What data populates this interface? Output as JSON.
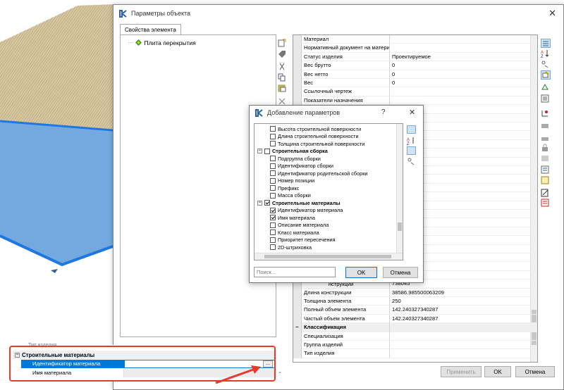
{
  "window": {
    "title": "Параметры объекта",
    "close": "✕",
    "tab": "Свойства элемента",
    "tree_item": "Плита перекрытия"
  },
  "grid": {
    "rows": [
      {
        "name": "Материал",
        "value": "",
        "cat": false
      },
      {
        "name": "Нормативный документ на материал",
        "value": "",
        "cat": false
      },
      {
        "name": "Статус изделия",
        "value": "Проектируемое",
        "cat": false
      },
      {
        "name": "Вес брутто",
        "value": "0",
        "cat": false
      },
      {
        "name": "Вес нетто",
        "value": "0",
        "cat": false
      },
      {
        "name": "Вес",
        "value": "0",
        "cat": false
      },
      {
        "name": "Ссылочный чертеж",
        "value": "",
        "cat": false
      },
      {
        "name": "Показатели назначения",
        "value": "",
        "cat": false
      },
      {
        "name": "",
        "value": "",
        "cat": false
      },
      {
        "name": "",
        "value": "",
        "cat": false
      },
      {
        "name": "",
        "value": "",
        "cat": false
      },
      {
        "name": "",
        "value": "",
        "cat": false
      },
      {
        "name": "",
        "value": "",
        "cat": false
      },
      {
        "name": "",
        "value": "",
        "cat": false
      },
      {
        "name": "",
        "value": "",
        "cat": false
      },
      {
        "name": "",
        "value": "",
        "cat": false
      },
      {
        "name": "",
        "value": "",
        "cat": false
      },
      {
        "name": "",
        "value": "",
        "cat": false
      },
      {
        "name": "",
        "value": "",
        "cat": false
      },
      {
        "name": "",
        "value": "",
        "cat": false
      },
      {
        "name": "",
        "value": "1148",
        "cat": false
      },
      {
        "name": "",
        "value": "1148",
        "cat": false
      },
      {
        "name": "",
        "value": "",
        "cat": false
      },
      {
        "name": "",
        "value": "",
        "cat": false
      },
      {
        "name": "",
        "value": "оверхность",
        "cat": false
      },
      {
        "name": "",
        "value": "",
        "cat": false
      },
      {
        "name": "",
        "value": "",
        "cat": false
      },
      {
        "name": "",
        "value": "",
        "cat": false
      },
      {
        "name": "",
        "value": "738045",
        "cat": false
      },
      {
        "name": "Длина конструкции",
        "value": "38586.985500063209",
        "cat": false
      },
      {
        "name": "Толщина элемента",
        "value": "250",
        "cat": false
      },
      {
        "name": "Полный объем элемента",
        "value": "142.240327340287",
        "cat": false
      },
      {
        "name": "Чистый объем элемента",
        "value": "142.240327340287",
        "cat": false
      },
      {
        "name": "Классификация",
        "value": "",
        "cat": true
      },
      {
        "name": "Специализация",
        "value": "",
        "cat": false
      },
      {
        "name": "Группа изделий",
        "value": "",
        "cat": false
      },
      {
        "name": "Тип изделия",
        "value": "",
        "cat": false
      }
    ],
    "partial_label": "Высота конструкции"
  },
  "buttons": {
    "apply": "Применить",
    "ok": "OK",
    "cancel": "Отмена"
  },
  "dialog": {
    "title": "Добавление параметров",
    "help": "?",
    "close": "✕",
    "items": [
      {
        "label": "Высота строительной поверхности",
        "type": "cb",
        "checked": false,
        "indent": 2
      },
      {
        "label": "Длина строительной поверхности",
        "type": "cb",
        "checked": false,
        "indent": 2
      },
      {
        "label": "Толщина строительной поверхности",
        "type": "cb",
        "checked": false,
        "indent": 2
      },
      {
        "label": "Строительная сборка",
        "type": "group",
        "checked": false,
        "indent": 1
      },
      {
        "label": "Подгруппа сборки",
        "type": "cb",
        "checked": false,
        "indent": 2
      },
      {
        "label": "Идентификатор сборки",
        "type": "cb",
        "checked": false,
        "indent": 2
      },
      {
        "label": "Идентификатор родительской сборки",
        "type": "cb",
        "checked": false,
        "indent": 2
      },
      {
        "label": "Номер позиции",
        "type": "cb",
        "checked": false,
        "indent": 2
      },
      {
        "label": "Префикс",
        "type": "cb",
        "checked": false,
        "indent": 2
      },
      {
        "label": "Масса сборки",
        "type": "cb",
        "checked": false,
        "indent": 2
      },
      {
        "label": "Строительные материалы",
        "type": "group",
        "checked": true,
        "indent": 1
      },
      {
        "label": "Идентификатор материала",
        "type": "cb",
        "checked": true,
        "indent": 2
      },
      {
        "label": "Имя материала",
        "type": "cb",
        "checked": true,
        "indent": 2
      },
      {
        "label": "Описание материала",
        "type": "cb",
        "checked": false,
        "indent": 2
      },
      {
        "label": "Класс материала",
        "type": "cb",
        "checked": false,
        "indent": 2
      },
      {
        "label": "Приоритет пересечения",
        "type": "cb",
        "checked": false,
        "indent": 2
      },
      {
        "label": "2D-штриховка",
        "type": "cb",
        "checked": false,
        "indent": 2
      }
    ],
    "search_placeholder": "Поиск...",
    "ok": "OK",
    "cancel": "Отмена"
  },
  "bottom_panel": {
    "category": "Строительные материалы",
    "row1": "Идентификатор материала",
    "row2": "Имя материала",
    "ellipsis": "...",
    "clipped_header": "Тип изделия"
  },
  "colors": {
    "accent": "#0078d7",
    "plate": "#5b9ad8",
    "edge": "#1e78e0",
    "arrow": "#e53b2b"
  }
}
